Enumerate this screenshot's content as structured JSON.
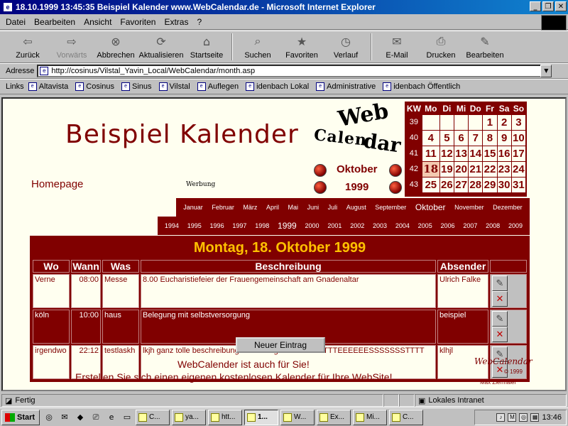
{
  "window": {
    "title": "18.10.1999 13:45:35 Beispiel Kalender www.WebCalendar.de - Microsoft Internet Explorer"
  },
  "menu": [
    "Datei",
    "Bearbeiten",
    "Ansicht",
    "Favoriten",
    "Extras",
    "?"
  ],
  "toolbar": [
    {
      "label": "Zurück",
      "icon": "back-arrow-icon",
      "enabled": true
    },
    {
      "label": "Vorwärts",
      "icon": "forward-arrow-icon",
      "enabled": false
    },
    {
      "label": "Abbrechen",
      "icon": "stop-icon",
      "enabled": true
    },
    {
      "label": "Aktualisieren",
      "icon": "refresh-icon",
      "enabled": true
    },
    {
      "label": "Startseite",
      "icon": "home-icon",
      "enabled": true
    },
    {
      "label": "Suchen",
      "icon": "search-icon",
      "enabled": true
    },
    {
      "label": "Favoriten",
      "icon": "favorites-icon",
      "enabled": true
    },
    {
      "label": "Verlauf",
      "icon": "history-icon",
      "enabled": true
    },
    {
      "label": "E-Mail",
      "icon": "mail-icon",
      "enabled": true
    },
    {
      "label": "Drucken",
      "icon": "print-icon",
      "enabled": true
    },
    {
      "label": "Bearbeiten",
      "icon": "edit-icon",
      "enabled": true
    }
  ],
  "address": {
    "label": "Adresse",
    "url": "http://cosinus/Vilstal_Yavin_Local/WebCalendar/month.asp"
  },
  "links": {
    "label": "Links",
    "items": [
      "Altavista",
      "Cosinus",
      "Sinus",
      "Vilstal",
      "Auflegen",
      "idenbach Lokal",
      "Administrative",
      "idenbach Öffentlich"
    ]
  },
  "page": {
    "title": "Beispiel Kalender",
    "homepage": "Homepage",
    "werbung": "Werbung",
    "logo": {
      "line1": "Web",
      "line2a": "Calen",
      "line2b": "dar"
    },
    "nav": {
      "month": "Oktober",
      "year": "1999"
    },
    "minical": {
      "headers": [
        "KW",
        "Mo",
        "Di",
        "Mi",
        "Do",
        "Fr",
        "Sa",
        "So"
      ],
      "weeks": [
        {
          "kw": "39",
          "days": [
            "",
            "",
            "",
            "",
            "1",
            "2",
            "3"
          ]
        },
        {
          "kw": "40",
          "days": [
            "4",
            "5",
            "6",
            "7",
            "8",
            "9",
            "10"
          ]
        },
        {
          "kw": "41",
          "days": [
            "11",
            "12",
            "13",
            "14",
            "15",
            "16",
            "17"
          ]
        },
        {
          "kw": "42",
          "days": [
            "18",
            "19",
            "20",
            "21",
            "22",
            "23",
            "24"
          ]
        },
        {
          "kw": "43",
          "days": [
            "25",
            "26",
            "27",
            "28",
            "29",
            "30",
            "31"
          ]
        }
      ],
      "today": "18"
    },
    "months": [
      "Januar",
      "Februar",
      "März",
      "April",
      "Mai",
      "Juni",
      "Juli",
      "August",
      "September",
      "Oktober",
      "November",
      "Dezember"
    ],
    "selectedMonth": "Oktober",
    "years": [
      "1994",
      "1995",
      "1996",
      "1997",
      "1998",
      "1999",
      "2000",
      "2001",
      "2002",
      "2003",
      "2004",
      "2005",
      "2006",
      "2007",
      "2008",
      "2009"
    ],
    "selectedYear": "1999",
    "dayHeader": "Montag, 18. Oktober 1999",
    "columns": [
      "Wo",
      "Wann",
      "Was",
      "Beschreibung",
      "Absender",
      ""
    ],
    "entries": [
      {
        "wo": "Verne",
        "wann": "08:00",
        "was": "Messe",
        "beschreibung": "8.00 Eucharistiefeier der Frauengemeinschaft am Gnadenaltar",
        "absender": "Ulrich Falke"
      },
      {
        "wo": "köln",
        "wann": "10:00",
        "was": "haus",
        "beschreibung": "Belegung mit selbstversorgung",
        "absender": "beispiel"
      },
      {
        "wo": "irgendwo",
        "wann": "22:12",
        "was": "testlaskh",
        "beschreibung": "lkjh ganz tolle beschreibung für einen ganz tollen TTTTTEEEEEESSSSSSSTTTT",
        "absender": "klhjl"
      }
    ],
    "newEntry": "Neuer Eintrag",
    "promo1": "WebCalender ist auch für Sie!",
    "promo2": "Erstellen Sie sich einen eigenen kostenlosen Kalender für Ihre WebSite!",
    "smallLogo": "WebCalendar",
    "copyright": "© 1999",
    "author": "Max Ziermaier"
  },
  "status": {
    "text": "Fertig",
    "zone": "Lokales Intranet"
  },
  "taskbar": {
    "start": "Start",
    "tasks": [
      "C...",
      "ya...",
      "htt...",
      "1...",
      "W...",
      "Ex...",
      "Mi...",
      "C..."
    ],
    "activeTask": 3,
    "clock": "13:46"
  }
}
